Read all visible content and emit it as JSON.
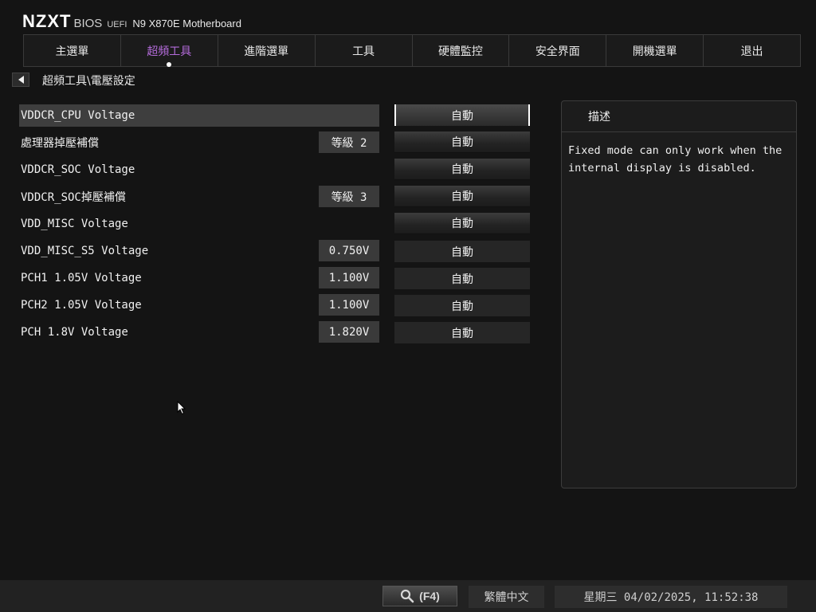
{
  "header": {
    "logo": "NZXT",
    "bios_text": "BIOS",
    "uefi_text": "UEFI",
    "model": "N9 X870E Motherboard"
  },
  "tabs": [
    {
      "label": "主選單"
    },
    {
      "label": "超頻工具",
      "active": true
    },
    {
      "label": "進階選單"
    },
    {
      "label": "工具"
    },
    {
      "label": "硬體監控"
    },
    {
      "label": "安全界面"
    },
    {
      "label": "開機選單"
    },
    {
      "label": "退出"
    }
  ],
  "breadcrumb": "超頻工具\\電壓設定",
  "settings": [
    {
      "label": "VDDCR_CPU Voltage",
      "value": "",
      "mode": "自動"
    },
    {
      "label": "處理器掉壓補償",
      "value": "等級 2",
      "mode": "自動"
    },
    {
      "label": "VDDCR_SOC Voltage",
      "value": "",
      "mode": "自動"
    },
    {
      "label": "VDDCR_SOC掉壓補償",
      "value": "等級 3",
      "mode": "自動"
    },
    {
      "label": "VDD_MISC Voltage",
      "value": "",
      "mode": "自動"
    },
    {
      "label": "VDD_MISC_S5 Voltage",
      "value": "0.750V",
      "mode": "自動"
    },
    {
      "label": "PCH1 1.05V Voltage",
      "value": "1.100V",
      "mode": "自動"
    },
    {
      "label": "PCH2 1.05V Voltage",
      "value": "1.100V",
      "mode": "自動"
    },
    {
      "label": "PCH 1.8V Voltage",
      "value": "1.820V",
      "mode": "自動"
    }
  ],
  "description": {
    "title": "描述",
    "text_line1": "Fixed mode can only work when the",
    "text_line2": "internal display is disabled."
  },
  "footer": {
    "search_label": "(F4)",
    "language": "繁體中文",
    "datetime": "星期三 04/02/2025, 11:52:38"
  },
  "colors": {
    "active_tab": "#b36bd9",
    "background": "#141414"
  }
}
